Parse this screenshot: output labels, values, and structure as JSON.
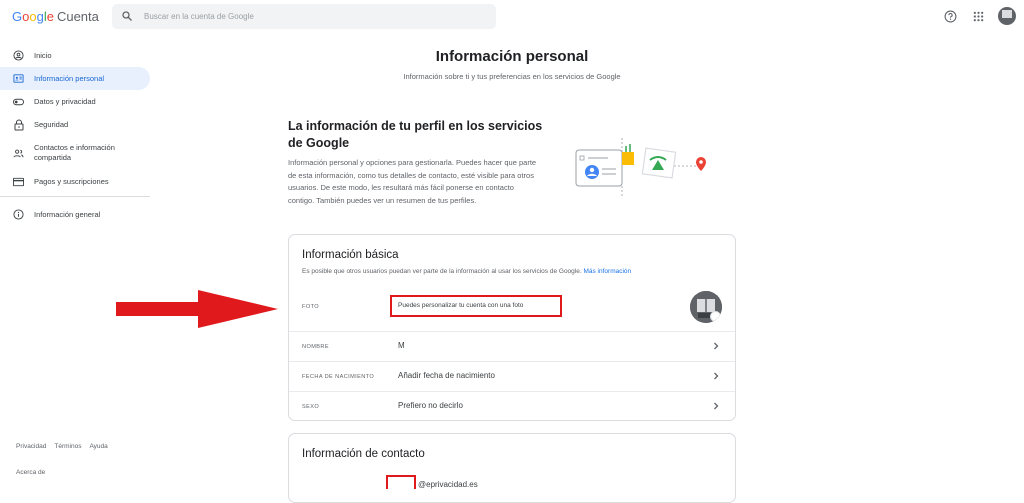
{
  "header": {
    "logo_word": [
      "G",
      "o",
      "o",
      "g",
      "l",
      "e"
    ],
    "product": "Cuenta",
    "search_placeholder": "Buscar en la cuenta de Google"
  },
  "sidebar": {
    "items": [
      {
        "label": "Inicio",
        "icon": "person-circle-icon"
      },
      {
        "label": "Información personal",
        "icon": "id-card-icon",
        "active": true
      },
      {
        "label": "Datos y privacidad",
        "icon": "toggle-icon"
      },
      {
        "label": "Seguridad",
        "icon": "lock-icon"
      },
      {
        "label": "Contactos e información compartida",
        "icon": "people-icon"
      },
      {
        "label": "Pagos y suscripciones",
        "icon": "credit-card-icon"
      }
    ],
    "general": {
      "label": "Información general",
      "icon": "info-icon"
    },
    "footer_links": [
      "Privacidad",
      "Términos",
      "Ayuda"
    ],
    "footer_about": "Acerca de"
  },
  "main": {
    "title": "Información personal",
    "subtitle": "Información sobre ti y tus preferencias en los servicios de Google",
    "profile_title": "La información de tu perfil en los servicios de Google",
    "profile_desc": "Información personal y opciones para gestionarla. Puedes hacer que parte de esta información, como tus detalles de contacto, esté visible para otros usuarios. De este modo, les resultará más fácil ponerse en contacto contigo. También puedes ver un resumen de tus perfiles."
  },
  "basic_info": {
    "title": "Información básica",
    "subtitle": "Es posible que otros usuarios puedan ver parte de la información al usar los servicios de Google.",
    "more_link": "Más información",
    "rows": [
      {
        "label": "FOTO",
        "value": "Puedes personalizar tu cuenta con una foto"
      },
      {
        "label": "NOMBRE",
        "value": "M"
      },
      {
        "label": "FECHA DE NACIMIENTO",
        "value": "Añadir fecha de nacimiento"
      },
      {
        "label": "SEXO",
        "value": "Prefiero no decirlo"
      }
    ]
  },
  "contact_info": {
    "title": "Información de contacto",
    "email_partial": "@eprivacidad.es"
  },
  "colors": {
    "accent": "#1a73e8",
    "active_bg": "#e8f0fe",
    "highlight_red": "#e0191d"
  }
}
